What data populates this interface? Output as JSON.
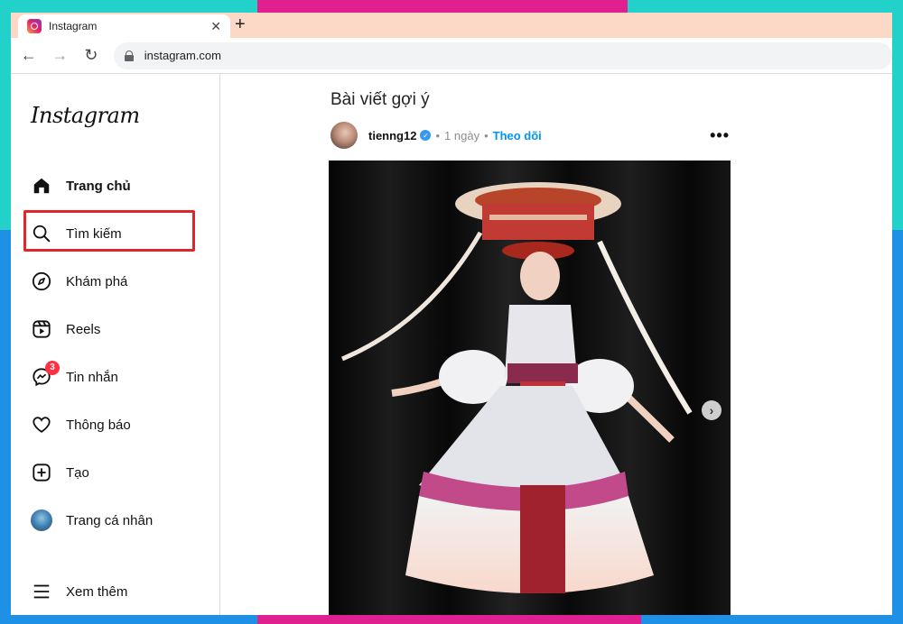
{
  "browser": {
    "tab_title": "Instagram",
    "tab_close": "✕",
    "new_tab": "+",
    "url": "instagram.com",
    "back": "←",
    "forward": "→",
    "reload": "↻"
  },
  "sidebar": {
    "logo": "Instagram",
    "items": [
      {
        "label": "Trang chủ",
        "icon": "home-icon"
      },
      {
        "label": "Tìm kiếm",
        "icon": "search-icon"
      },
      {
        "label": "Khám phá",
        "icon": "compass-icon"
      },
      {
        "label": "Reels",
        "icon": "reels-icon"
      },
      {
        "label": "Tin nhắn",
        "icon": "messenger-icon",
        "badge": "3"
      },
      {
        "label": "Thông báo",
        "icon": "heart-icon"
      },
      {
        "label": "Tạo",
        "icon": "create-icon"
      },
      {
        "label": "Trang cá nhân",
        "icon": "profile-avatar"
      },
      {
        "label": "Xem thêm",
        "icon": "menu-icon"
      }
    ]
  },
  "main": {
    "section_title": "Bài viết gợi ý",
    "post": {
      "username": "tienng12",
      "separator": "•",
      "time": "1 ngày",
      "follow": "Theo dõi",
      "more": "•••",
      "next": "›"
    }
  },
  "colors": {
    "highlight": "#e0262a",
    "link": "#0095f6",
    "badge": "#ff3040",
    "verified": "#3897f0"
  }
}
